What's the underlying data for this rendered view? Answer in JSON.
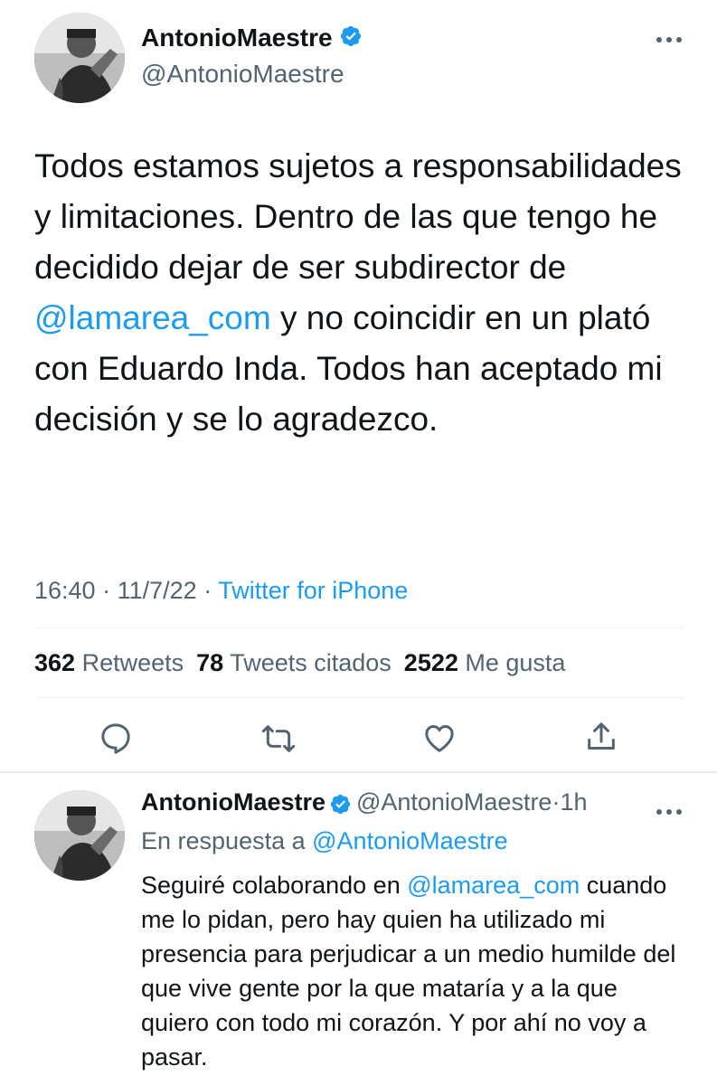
{
  "main_tweet": {
    "author": {
      "display_name": "AntonioMaestre",
      "handle": "@AntonioMaestre",
      "verified_icon": "verified-badge-icon"
    },
    "more_menu_icon": "more-horizontal-icon",
    "text": {
      "part1": "Todos estamos sujetos a responsabilidades y limitaciones. Dentro de las que tengo he decidido dejar de ser subdirector de ",
      "mention": "@lamarea_com",
      "part2": " y no coincidir en un plató con Eduardo Inda. Todos han aceptado mi decisión y se lo agradezco."
    },
    "time": "16:40",
    "date": "11/7/22",
    "separator": "·",
    "source": "Twitter for iPhone",
    "stats": {
      "retweets_count": "362",
      "retweets_label": "Retweets",
      "quotes_count": "78",
      "quotes_label": "Tweets citados",
      "likes_count": "2522",
      "likes_label": "Me gusta"
    },
    "actions": [
      "reply-icon",
      "retweet-icon",
      "like-icon",
      "share-icon"
    ]
  },
  "reply_tweet": {
    "author": {
      "display_name": "AntonioMaestre",
      "handle": "@AntonioMaestre",
      "separator": "·",
      "time_ago": "1h"
    },
    "reply_to_label": "En respuesta a",
    "reply_to_handle": "@AntonioMaestre",
    "text": {
      "part1": "Seguiré colaborando en ",
      "mention": "@lamarea_com",
      "part2": " cuando me lo pidan, pero hay quien ha utilizado mi presencia para perjudicar a un medio humilde del que vive gente por la que mataría y a la que quiero con todo mi corazón. Y por ahí no voy a pasar."
    }
  },
  "colors": {
    "primary_text": "#0f1419",
    "secondary_text": "#536471",
    "accent_blue": "#1d9bf0",
    "divider": "#eff3f4"
  }
}
